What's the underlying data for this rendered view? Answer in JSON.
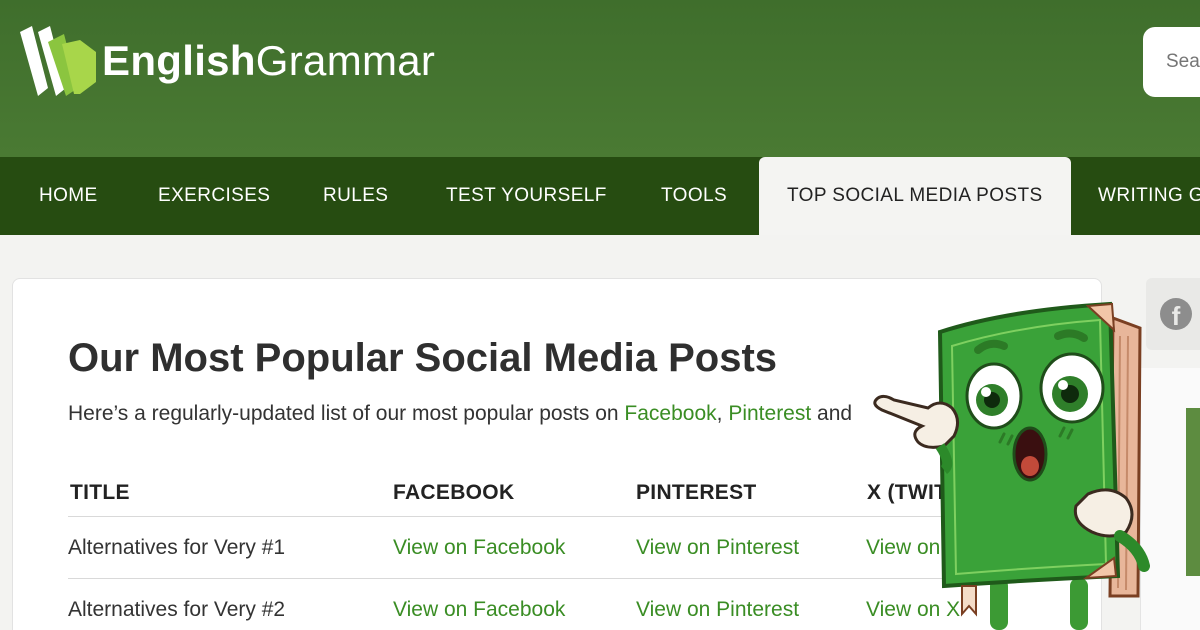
{
  "header": {
    "logo_bold": "English",
    "logo_light": "Grammar",
    "search_placeholder": "Search"
  },
  "nav": {
    "items": [
      {
        "label": "HOME"
      },
      {
        "label": "EXERCISES"
      },
      {
        "label": "RULES"
      },
      {
        "label": "TEST YOURSELF"
      },
      {
        "label": "TOOLS"
      },
      {
        "label": "TOP SOCIAL MEDIA POSTS",
        "active": true
      },
      {
        "label": "WRITING G"
      }
    ]
  },
  "main": {
    "title": "Our Most Popular Social Media Posts",
    "intro": {
      "prefix": "Here’s a regularly-updated list of our most popular posts on ",
      "facebook": "Facebook",
      "sep": ", ",
      "pinterest": "Pinterest",
      "suffix": " and"
    },
    "table": {
      "headers": [
        "TITLE",
        "FACEBOOK",
        "PINTEREST",
        "X (TWITTER)"
      ],
      "rows": [
        {
          "title": "Alternatives for Very #1",
          "facebook": "View on Facebook",
          "pinterest": "View on Pinterest",
          "x": "View on X"
        },
        {
          "title": "Alternatives for Very #2",
          "facebook": "View on Facebook",
          "pinterest": "View on Pinterest",
          "x": "View on X"
        }
      ]
    }
  },
  "sidebar": {
    "share_icon": "facebook-icon"
  },
  "colors": {
    "header_green": "#4a7a33",
    "nav_dark_green": "#264c11",
    "link_green": "#3a8d24",
    "logo_lime": "#8bc53f"
  }
}
